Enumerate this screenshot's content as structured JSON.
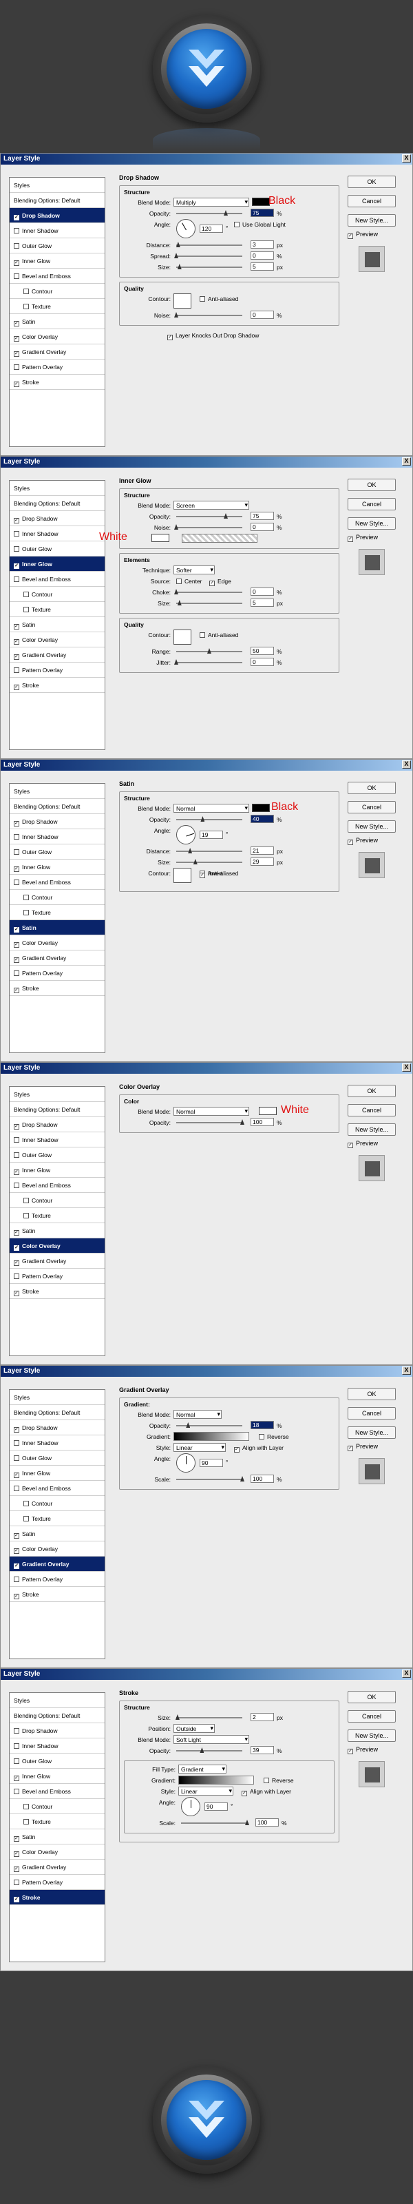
{
  "hero": {
    "top_logo": "chevron-badge-icon",
    "bottom_logo": "chevron-badge-icon"
  },
  "common": {
    "title": "Layer Style",
    "close": "X",
    "ok": "OK",
    "cancel": "Cancel",
    "new_style": "New Style...",
    "preview": "Preview",
    "styles_header": "Styles",
    "blending_options": "Blending Options: Default",
    "layer_items": [
      "Drop Shadow",
      "Inner Shadow",
      "Outer Glow",
      "Inner Glow",
      "Bevel and Emboss",
      "Contour",
      "Texture",
      "Satin",
      "Color Overlay",
      "Gradient Overlay",
      "Pattern Overlay",
      "Stroke"
    ],
    "labels": {
      "structure": "Structure",
      "quality": "Quality",
      "elements": "Elements",
      "blend_mode": "Blend Mode:",
      "opacity": "Opacity:",
      "angle": "Angle:",
      "distance": "Distance:",
      "spread": "Spread:",
      "size": "Size:",
      "contour": "Contour:",
      "noise": "Noise:",
      "technique": "Technique:",
      "source": "Source:",
      "choke": "Choke:",
      "range": "Range:",
      "jitter": "Jitter:",
      "gradient": "Gradient:",
      "style": "Style:",
      "scale": "Scale:",
      "position": "Position:",
      "fill_type": "Fill Type:",
      "color": "Color",
      "anti_aliased": "Anti-aliased",
      "use_global_light": "Use Global Light",
      "invert": "Invert",
      "reverse": "Reverse",
      "align_with_layer": "Align with Layer",
      "layer_knocks_out": "Layer Knocks Out Drop Shadow",
      "center": "Center",
      "edge": "Edge",
      "px": "px",
      "pct": "%",
      "deg": "°"
    }
  },
  "dialogs": [
    {
      "panel": "Drop Shadow",
      "checked": [
        true,
        false,
        false,
        true,
        false,
        false,
        false,
        true,
        true,
        true,
        false,
        true
      ],
      "selected": 0,
      "blend_mode": "Multiply",
      "opacity": "75",
      "angle": "120",
      "distance": "3",
      "spread": "0",
      "size": "5",
      "noise": "0",
      "annotation": "Black",
      "chip_color": "#000000"
    },
    {
      "panel": "Inner Glow",
      "checked": [
        true,
        false,
        false,
        true,
        false,
        false,
        false,
        true,
        true,
        true,
        false,
        true
      ],
      "selected": 3,
      "blend_mode": "Screen",
      "opacity": "75",
      "noise": "0",
      "technique": "Softer",
      "choke": "0",
      "size": "5",
      "range": "50",
      "jitter": "0",
      "annotation": "White",
      "chip_color": "#ffffff"
    },
    {
      "panel": "Satin",
      "checked": [
        true,
        false,
        false,
        true,
        false,
        false,
        false,
        true,
        true,
        true,
        false,
        true
      ],
      "selected": 7,
      "blend_mode": "Normal",
      "opacity": "40",
      "angle": "19",
      "distance": "21",
      "size": "29",
      "annotation": "Black",
      "chip_color": "#000000"
    },
    {
      "panel": "Color Overlay",
      "checked": [
        true,
        false,
        false,
        true,
        false,
        false,
        false,
        true,
        true,
        true,
        false,
        true
      ],
      "selected": 8,
      "blend_mode": "Normal",
      "opacity": "100",
      "annotation": "White",
      "chip_color": "#ffffff"
    },
    {
      "panel": "Gradient Overlay",
      "checked": [
        true,
        false,
        false,
        true,
        false,
        false,
        false,
        true,
        true,
        true,
        false,
        true
      ],
      "selected": 9,
      "blend_mode": "Normal",
      "opacity": "18",
      "style": "Linear",
      "angle": "90",
      "scale": "100"
    },
    {
      "panel": "Stroke",
      "checked": [
        false,
        false,
        false,
        true,
        false,
        false,
        false,
        true,
        true,
        true,
        false,
        true
      ],
      "selected": 11,
      "size": "2",
      "position": "Outside",
      "blend_mode": "Soft Light",
      "opacity": "39",
      "fill_type": "Gradient",
      "style": "Linear",
      "angle": "90",
      "scale": "100"
    }
  ]
}
